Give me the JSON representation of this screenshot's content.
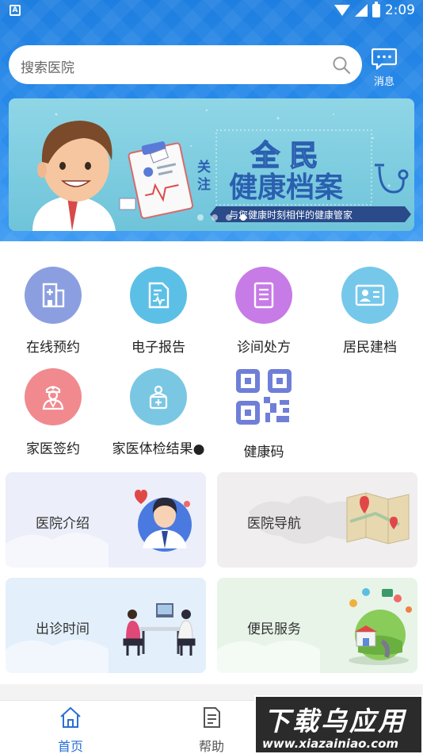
{
  "status_bar": {
    "left_icon": "A",
    "time": "2:09"
  },
  "search": {
    "placeholder": "搜索医院"
  },
  "message": {
    "label": "消息"
  },
  "banner": {
    "title_line1": "全 民",
    "title_line2": "健康档案",
    "side_text": "关注",
    "subtitle": "与您健康时刻相伴的健康管家",
    "dots_count": 4,
    "active_dot": 3
  },
  "grid": [
    {
      "label": "在线预约",
      "icon": "hospital-icon",
      "color": "#8b9fe0"
    },
    {
      "label": "电子报告",
      "icon": "report-icon",
      "color": "#5cc0e6"
    },
    {
      "label": "诊间处方",
      "icon": "prescription-icon",
      "color": "#c77be6"
    },
    {
      "label": "居民建档",
      "icon": "id-card-icon",
      "color": "#76c8ea"
    },
    {
      "label": "家医签约",
      "icon": "doctor-icon",
      "color": "#f08a8f"
    },
    {
      "label": "家医体检结果●",
      "icon": "checkup-icon",
      "color": "#7ac7e3"
    },
    {
      "label": "健康码",
      "icon": "qr-code-icon",
      "color": "#6f7fd8"
    }
  ],
  "cards": [
    {
      "label": "医院介绍",
      "bg": "#eceefa"
    },
    {
      "label": "医院导航",
      "bg": "#f0eeee"
    },
    {
      "label": "出诊时间",
      "bg": "#e3effa"
    },
    {
      "label": "便民服务",
      "bg": "#e8f4e8"
    }
  ],
  "tabs": [
    {
      "label": "首页",
      "active": true
    },
    {
      "label": "帮助",
      "active": false
    }
  ],
  "watermark": {
    "big": "下载乌应用",
    "small": "www.xiazainiao.com"
  },
  "colors": {
    "header_blue": "#2a8cec",
    "active_tab": "#2a6fd6"
  }
}
